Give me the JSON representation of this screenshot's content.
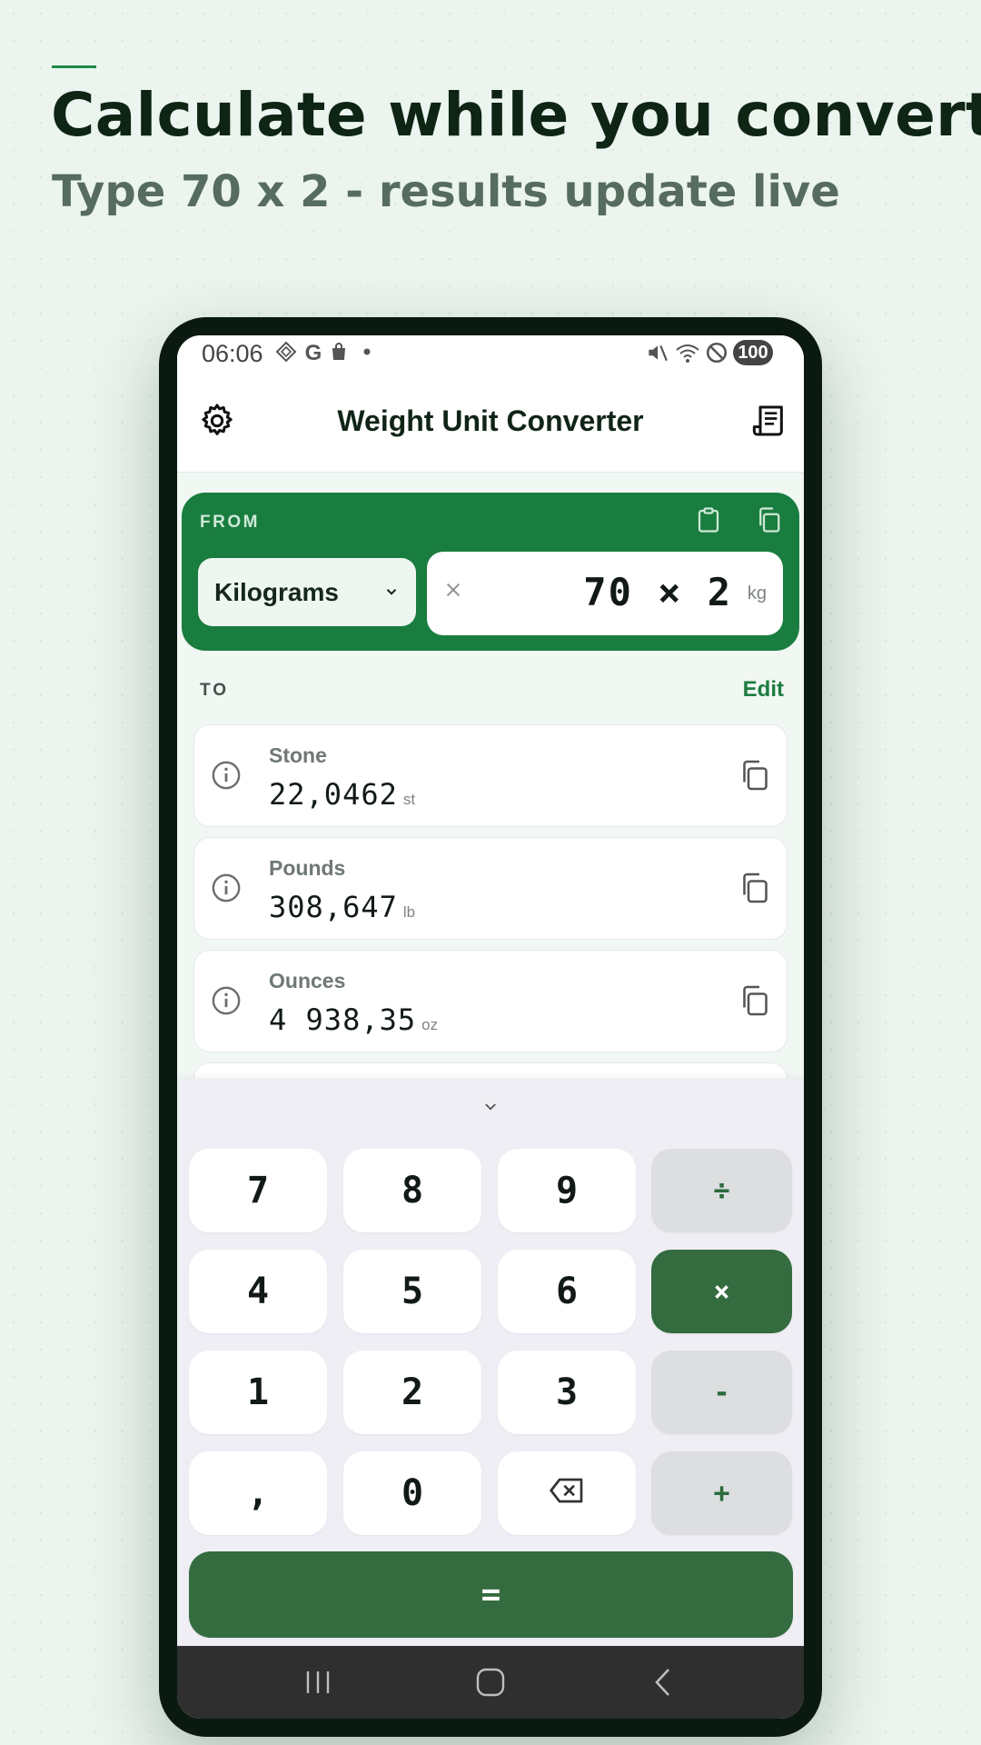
{
  "promo": {
    "headline": "Calculate while you convert",
    "subhead": "Type 70 x 2 - results update live"
  },
  "status_bar": {
    "time": "06:06",
    "battery": "100",
    "left_icons": [
      "app-icon",
      "google-icon",
      "shopping-bag-icon",
      "dot-icon"
    ],
    "right_icons": [
      "mute-icon",
      "wifi-icon",
      "dnd-icon"
    ]
  },
  "app_bar": {
    "title": "Weight Unit Converter",
    "left_icon": "gear-icon",
    "right_icon": "receipt-icon"
  },
  "from": {
    "label": "FROM",
    "unit": "Kilograms",
    "expression": "70 × 2",
    "unit_symbol": "kg",
    "actions": [
      "paste-icon",
      "copy-icon"
    ]
  },
  "to": {
    "label": "TO",
    "edit_label": "Edit",
    "results": [
      {
        "name": "Stone",
        "value": "22,0462",
        "unit": "st"
      },
      {
        "name": "Pounds",
        "value": "308,647",
        "unit": "lb"
      },
      {
        "name": "Ounces",
        "value": "4 938,35",
        "unit": "oz"
      }
    ]
  },
  "keypad": {
    "keys": {
      "k7": "7",
      "k8": "8",
      "k9": "9",
      "div": "÷",
      "k4": "4",
      "k5": "5",
      "k6": "6",
      "mul": "×",
      "k1": "1",
      "k2": "2",
      "k3": "3",
      "sub": "-",
      "comma": ",",
      "k0": "0",
      "add": "+",
      "equals": "="
    },
    "active_operator": "×"
  },
  "colors": {
    "brand_green": "#1a7d40",
    "dark_green": "#346b3f",
    "headline": "#0e2414",
    "subhead": "#566c5e"
  }
}
